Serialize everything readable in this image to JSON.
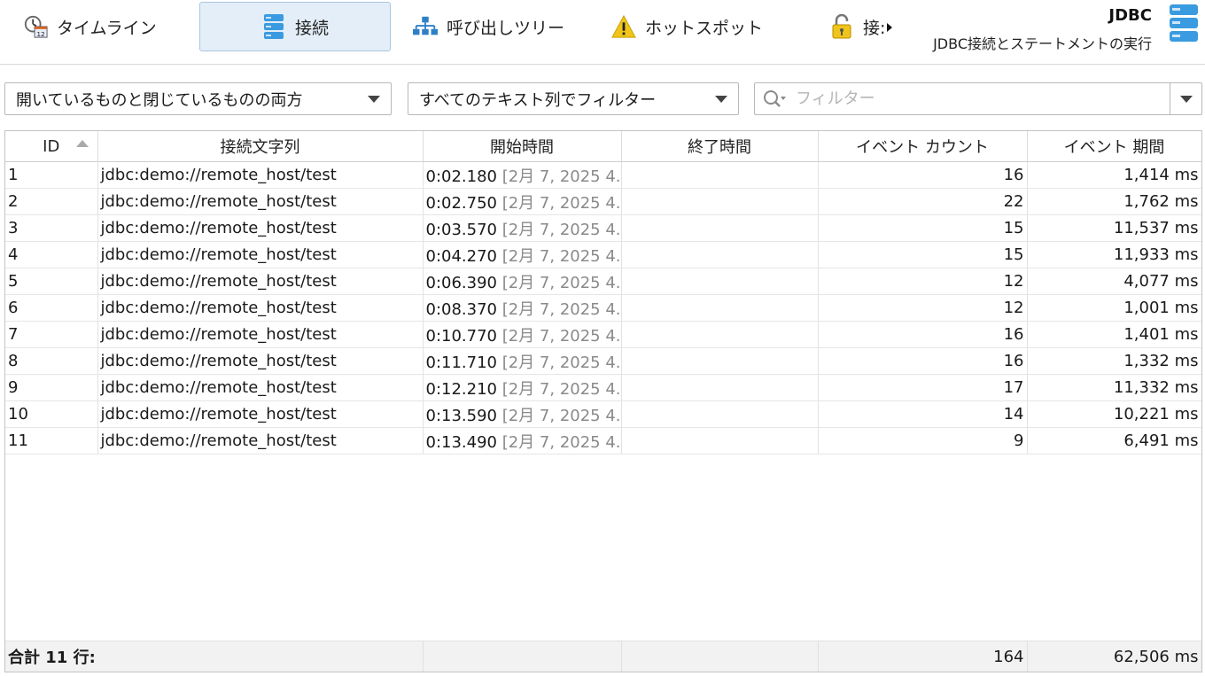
{
  "toolbar": {
    "tabs": [
      {
        "label": "タイムライン",
        "icon": "timeline-clock-icon"
      },
      {
        "label": "接続",
        "icon": "database-icon"
      },
      {
        "label": "呼び出しツリー",
        "icon": "call-tree-icon"
      },
      {
        "label": "ホットスポット",
        "icon": "warning-icon"
      },
      {
        "label": "接:",
        "icon": "lock-icon"
      }
    ],
    "title": "JDBC",
    "subtitle": "JDBC接続とステートメントの実行"
  },
  "filters": {
    "state_filter": "開いているものと閉じているものの両方",
    "column_filter": "すべてのテキスト列でフィルター",
    "search_placeholder": "フィルター"
  },
  "table": {
    "columns": [
      "ID",
      "接続文字列",
      "開始時間",
      "終了時間",
      "イベント カウント",
      "イベント 期間"
    ],
    "rows": [
      {
        "id": "1",
        "conn": "jdbc:demo://remote_host/test",
        "start": "0:02.180",
        "start_date": "[2月 7, 2025 4..",
        "end": "",
        "count": "16",
        "duration": "1,414 ms"
      },
      {
        "id": "2",
        "conn": "jdbc:demo://remote_host/test",
        "start": "0:02.750",
        "start_date": "[2月 7, 2025 4..",
        "end": "",
        "count": "22",
        "duration": "1,762 ms"
      },
      {
        "id": "3",
        "conn": "jdbc:demo://remote_host/test",
        "start": "0:03.570",
        "start_date": "[2月 7, 2025 4..",
        "end": "",
        "count": "15",
        "duration": "11,537 ms"
      },
      {
        "id": "4",
        "conn": "jdbc:demo://remote_host/test",
        "start": "0:04.270",
        "start_date": "[2月 7, 2025 4..",
        "end": "",
        "count": "15",
        "duration": "11,933 ms"
      },
      {
        "id": "5",
        "conn": "jdbc:demo://remote_host/test",
        "start": "0:06.390",
        "start_date": "[2月 7, 2025 4..",
        "end": "",
        "count": "12",
        "duration": "4,077 ms"
      },
      {
        "id": "6",
        "conn": "jdbc:demo://remote_host/test",
        "start": "0:08.370",
        "start_date": "[2月 7, 2025 4..",
        "end": "",
        "count": "12",
        "duration": "1,001 ms"
      },
      {
        "id": "7",
        "conn": "jdbc:demo://remote_host/test",
        "start": "0:10.770",
        "start_date": "[2月 7, 2025 4..",
        "end": "",
        "count": "16",
        "duration": "1,401 ms"
      },
      {
        "id": "8",
        "conn": "jdbc:demo://remote_host/test",
        "start": "0:11.710",
        "start_date": "[2月 7, 2025 4..",
        "end": "",
        "count": "16",
        "duration": "1,332 ms"
      },
      {
        "id": "9",
        "conn": "jdbc:demo://remote_host/test",
        "start": "0:12.210",
        "start_date": "[2月 7, 2025 4..",
        "end": "",
        "count": "17",
        "duration": "11,332 ms"
      },
      {
        "id": "10",
        "conn": "jdbc:demo://remote_host/test",
        "start": "0:13.590",
        "start_date": "[2月 7, 2025 4..",
        "end": "",
        "count": "14",
        "duration": "10,221 ms"
      },
      {
        "id": "11",
        "conn": "jdbc:demo://remote_host/test",
        "start": "0:13.490",
        "start_date": "[2月 7, 2025 4..",
        "end": "",
        "count": "9",
        "duration": "6,491 ms"
      }
    ],
    "footer": {
      "label": "合計 11 行:",
      "count": "164",
      "duration": "62,506 ms"
    }
  },
  "colors": {
    "accent": "#2b8fd6",
    "active_tab_bg": "#e3eef8",
    "warning": "#f0c419"
  }
}
